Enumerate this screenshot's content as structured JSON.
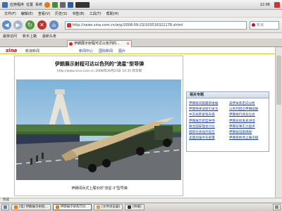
{
  "top_panel": {
    "applications": "应用程序",
    "places": "位置",
    "system": "系统",
    "clock": "12:06"
  },
  "menubar": [
    "文件(F)",
    "编辑(E)",
    "查看(V)",
    "历史(S)",
    "书签(B)",
    "工具(T)",
    "帮助(H)"
  ],
  "navbar": {
    "url": "http://news.sina.com.cn/w/p/2008-09-23/103516321178.shtml",
    "search_label": "新浪"
  },
  "bookmarks": [
    "最常访问",
    "新手上路",
    "最新头条"
  ],
  "tabs": [
    {
      "label": "伊朗展示射程可达以色列的..."
    }
  ],
  "page": {
    "logo": "sina",
    "site_name": "新浪新闻",
    "nav_links": [
      "新闻中心",
      "国际新闻",
      "图片"
    ],
    "headline": "伊朗展示射程可达以色列的\"流星\"型导弹",
    "dateline": "http://www.sina.com.cn 2008年09月23日 10:35 新华网",
    "caption": "伊朗阅兵式上展示的\"流星-3\"型导弹",
    "sidebox": {
      "title": "相关专题",
      "links": [
        "伊朗核问题最新进展",
        "美伊关系走向分析",
        "伊朗导弹试射引关注",
        "以色列回应伊朗威胁",
        "中东局势紧张升级",
        "伊朗举行阅兵仪式",
        "伊朗展示新型导弹",
        "伊朗总统发表讲话",
        "联合国安理会讨论",
        "伊朗军事实力盘点",
        "国际社会强烈反应",
        "伊朗核设施揭秘",
        "美国加强中东部署",
        "伊朗拒绝停止铀浓缩"
      ]
    }
  },
  "statusbar": "完成",
  "taskbar": [
    {
      "label": "[电] 伊朗展示射程...",
      "active": false
    },
    {
      "label": "伊朗展示射程可达...",
      "active": true
    },
    {
      "label": "[文件浏览器]",
      "active": false
    },
    {
      "label": "[终端]",
      "active": false
    }
  ],
  "colors": {
    "sina_red": "#d01010",
    "link_blue": "#1a3fa0",
    "panel_gray": "#d8d8d8"
  }
}
